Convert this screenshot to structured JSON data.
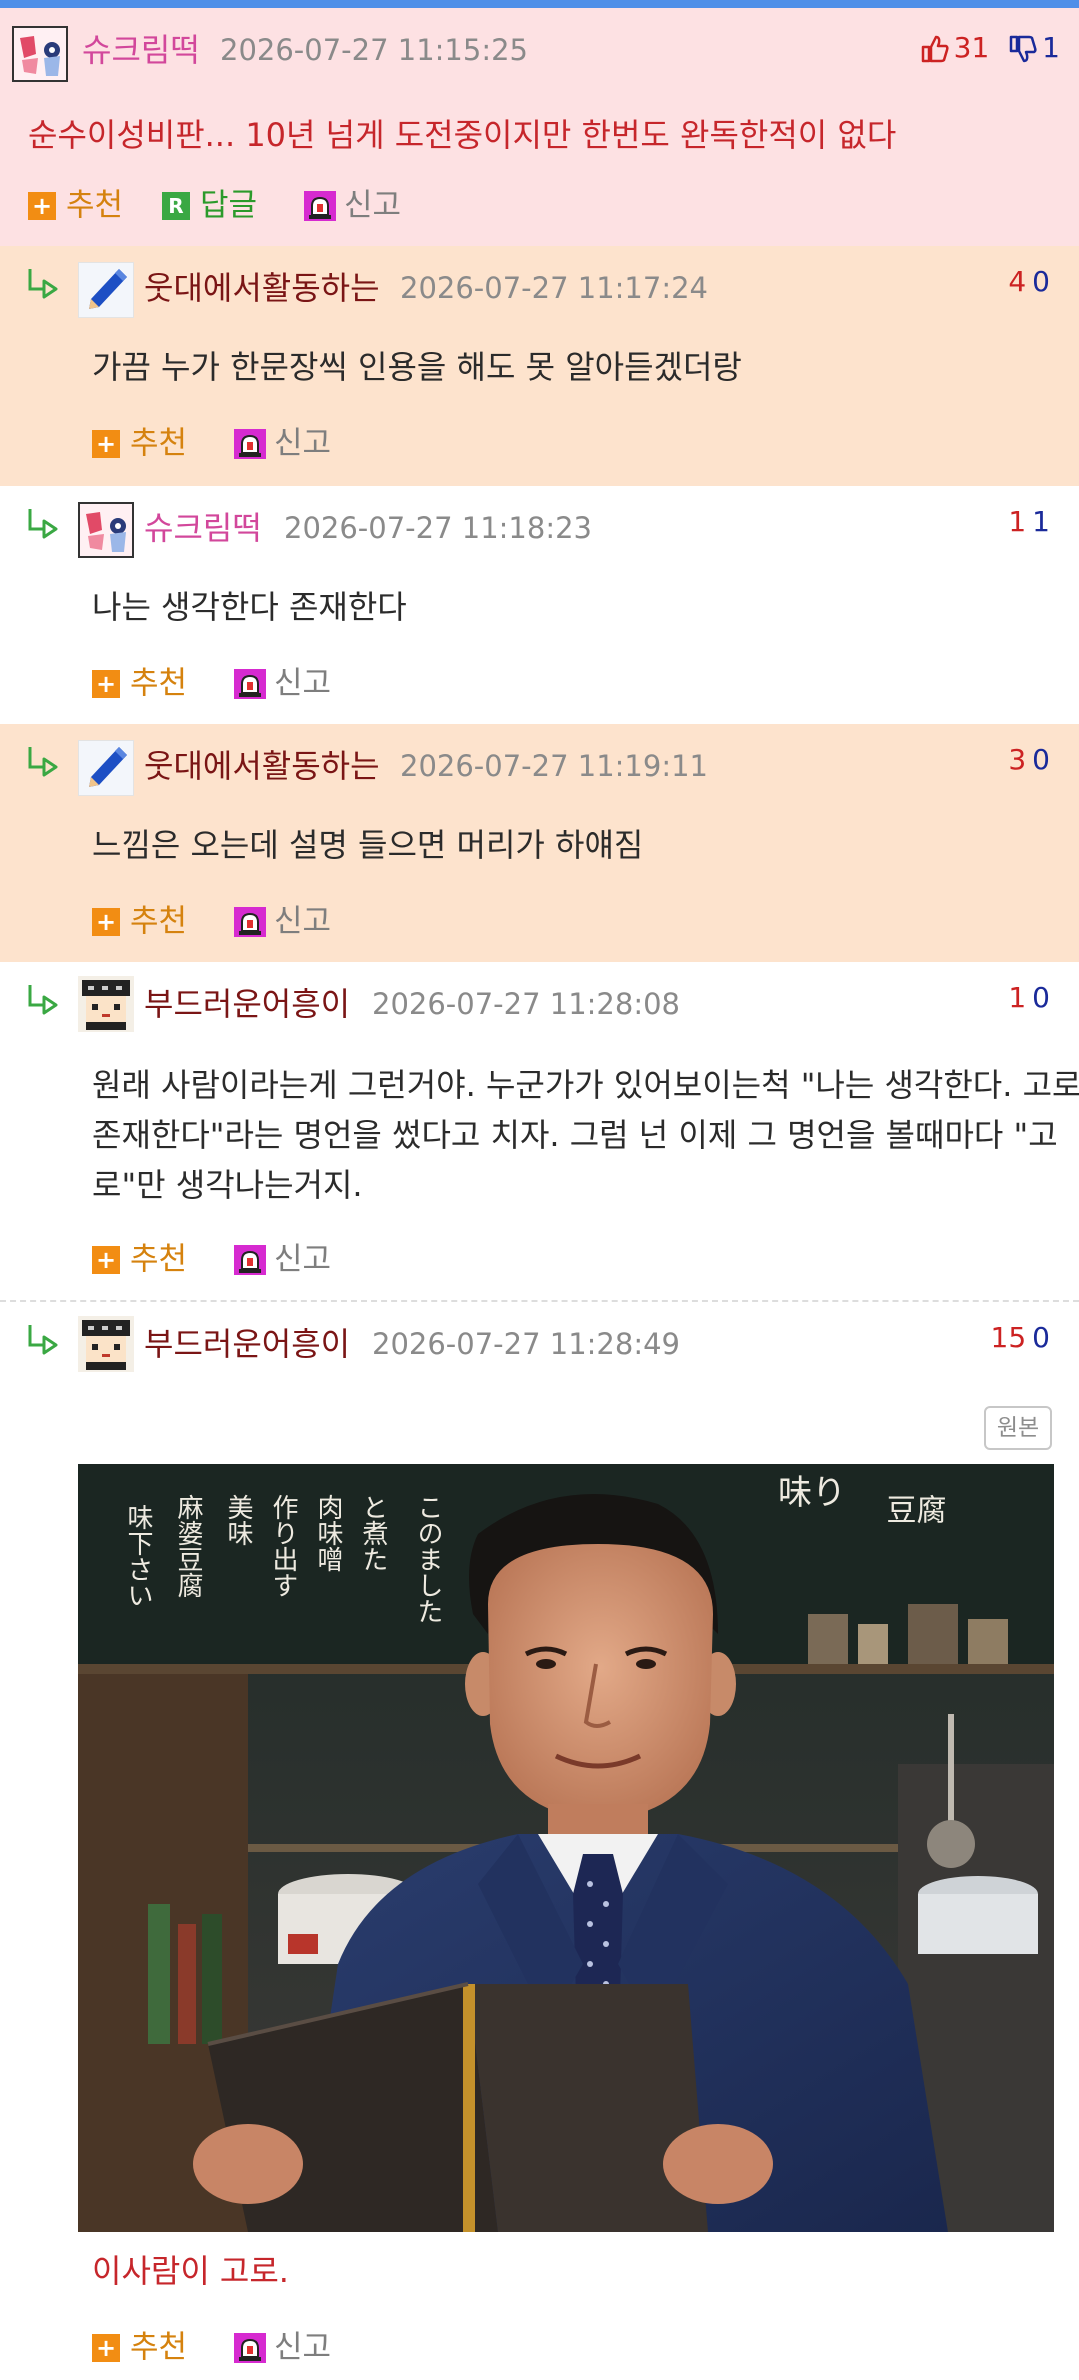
{
  "colors": {
    "best_bg": "#fde1e3",
    "reply_bg": "#fde3cd",
    "accent_bar": "#4f8fe8",
    "nick_pink": "#d2479b",
    "nick_dark": "#7a1515",
    "recommend": "#d5820e",
    "answer": "#2b9a2b",
    "report": "#7e7e7e",
    "up_vote": "#cc2222",
    "down_vote": "#1a2a9a"
  },
  "actions": {
    "recommend": "추천",
    "answer": "답글",
    "report": "신고",
    "original": "원본"
  },
  "best_comment": {
    "nickname": "슈크림떡",
    "date": "2026-07-27 11:15:25",
    "up": "31",
    "down": "1",
    "text": "순수이성비판... 10년 넘게 도전중이지만 한번도 완독한적이 없다",
    "icons": [
      "thumbs-up-icon",
      "thumbs-down-icon"
    ]
  },
  "replies": [
    {
      "nickname": "웃대에서활동하는",
      "date": "2026-07-27 11:17:24",
      "up": "4",
      "down": "0",
      "text": "가끔 누가 한문장씩 인용을 해도 못 알아듣겠더랑"
    },
    {
      "nickname": "슈크림떡",
      "date": "2026-07-27 11:18:23",
      "up": "1",
      "down": "1",
      "text": "나는 생각한다 존재한다"
    },
    {
      "nickname": "웃대에서활동하는",
      "date": "2026-07-27 11:19:11",
      "up": "3",
      "down": "0",
      "text": "느낌은 오는데 설명 들으면 머리가 하얘짐"
    },
    {
      "nickname": "부드러운어흥이",
      "date": "2026-07-27 11:28:08",
      "up": "1",
      "down": "0",
      "text_lines": [
        "원래 사람이라는게 그런거야. 누군가가 있어보이는척 \"나는 생각한다. 고로",
        "존재한다\"라는 명언을 썼다고 치자. 그럼 넌 이제 그 명언을 볼때마다 \"고",
        "로\"만 생각나는거지."
      ]
    },
    {
      "nickname": "부드러운어흥이",
      "date": "2026-07-27 11:28:49",
      "up": "15",
      "down": "0",
      "caption": "이사람이 고로."
    }
  ],
  "photo": {
    "signboard_text": [
      "味り",
      "豆",
      "腐",
      "このました",
      "と煮た",
      "肉味噌",
      "作り出す",
      "美味",
      "麻婆豆腐",
      "味下さい"
    ]
  }
}
